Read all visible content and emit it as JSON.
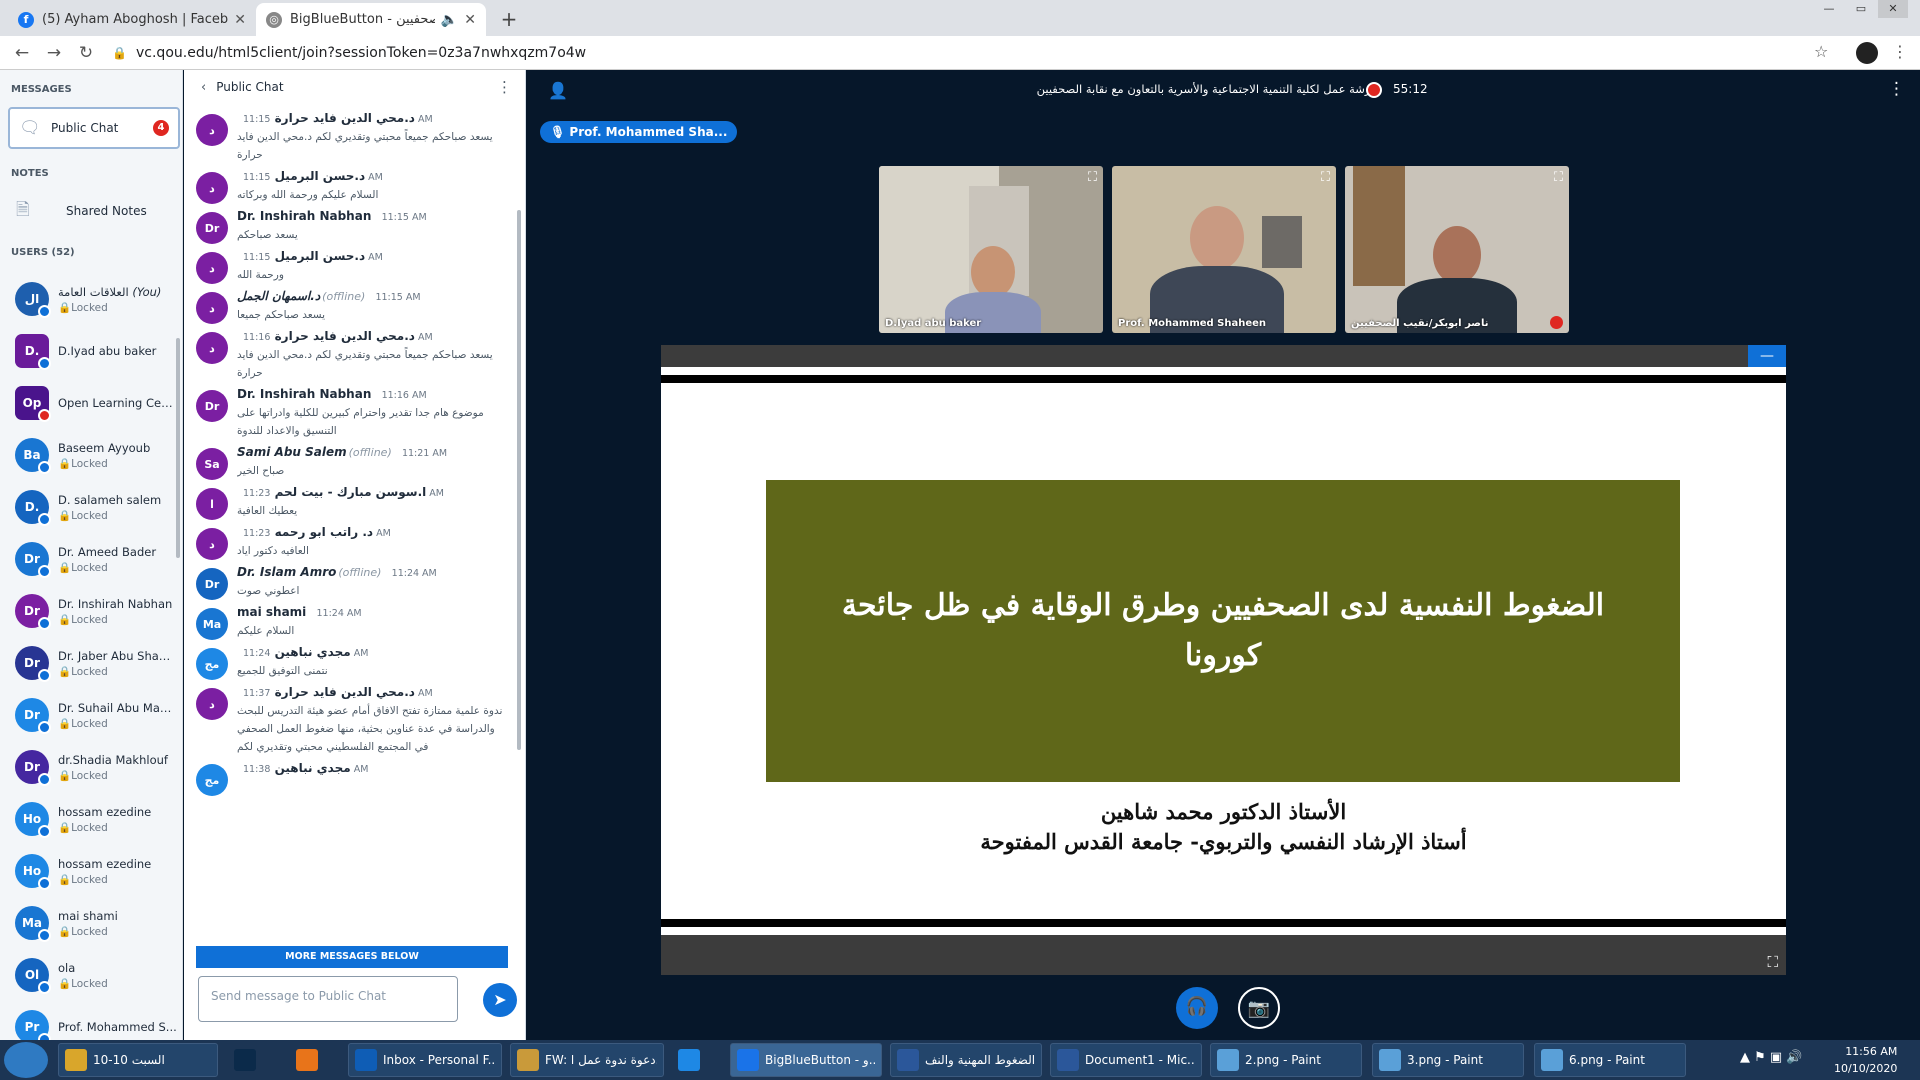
{
  "browser": {
    "tabs": [
      {
        "label": "(5) Ayham Aboghosh | Facebook",
        "icon": "facebook-icon"
      },
      {
        "label": "BigBlueButton - نقابة الصحفيين",
        "icon": "bigbluebutton-icon"
      }
    ],
    "url": "vc.qou.edu/html5client/join?sessionToken=0z3a7nwhxqzm7o4w"
  },
  "left_panel": {
    "messages_title": "MESSAGES",
    "public_chat_label": "Public Chat",
    "public_chat_badge": "4",
    "notes_title": "NOTES",
    "shared_notes_label": "Shared Notes",
    "users_title": "USERS (52)",
    "users": [
      {
        "name": "العلاقات العامة",
        "you": "(You)",
        "status": "Locked",
        "initials": "ال",
        "color": "#1e5fae",
        "dot": "audio",
        "square": false
      },
      {
        "name": "D.Iyad abu baker",
        "status": "",
        "initials": "D.",
        "color": "#6a1b9a",
        "dot": "audio",
        "square": true
      },
      {
        "name": "Open Learning Cent...",
        "status": "",
        "initials": "Op",
        "color": "#4a148c",
        "dot": "mute",
        "square": true
      },
      {
        "name": "Baseem Ayyoub",
        "status": "Locked",
        "initials": "Ba",
        "color": "#1976d2",
        "dot": "audio",
        "square": false
      },
      {
        "name": "D. salameh salem",
        "status": "Locked",
        "initials": "D.",
        "color": "#1565c0",
        "dot": "audio",
        "square": false
      },
      {
        "name": "Dr. Ameed Bader",
        "status": "Locked",
        "initials": "Dr",
        "color": "#1976d2",
        "dot": "audio",
        "square": false
      },
      {
        "name": "Dr. Inshirah Nabhan",
        "status": "Locked",
        "initials": "Dr",
        "color": "#7b1fa2",
        "dot": "audio",
        "square": false
      },
      {
        "name": "Dr. Jaber Abu Shaw...",
        "status": "Locked",
        "initials": "Dr",
        "color": "#283593",
        "dot": "audio",
        "square": false
      },
      {
        "name": "Dr. Suhail Abu Maya...",
        "status": "Locked",
        "initials": "Dr",
        "color": "#1e88e5",
        "dot": "audio",
        "square": false
      },
      {
        "name": "dr.Shadia Makhlouf",
        "status": "Locked",
        "initials": "Dr",
        "color": "#4527a0",
        "dot": "audio",
        "square": false
      },
      {
        "name": "hossam ezedine",
        "status": "Locked",
        "initials": "Ho",
        "color": "#1e88e5",
        "dot": "audio",
        "square": false
      },
      {
        "name": "hossam ezedine",
        "status": "Locked",
        "initials": "Ho",
        "color": "#1e88e5",
        "dot": "audio",
        "square": false
      },
      {
        "name": "mai shami",
        "status": "Locked",
        "initials": "Ma",
        "color": "#1976d2",
        "dot": "audio",
        "square": false
      },
      {
        "name": "ola",
        "status": "Locked",
        "initials": "Ol",
        "color": "#1565c0",
        "dot": "audio",
        "square": false
      },
      {
        "name": "Prof. Mohammed S...",
        "status": "",
        "initials": "Pr",
        "color": "#1e88e5",
        "dot": "audio",
        "square": false
      }
    ]
  },
  "chat": {
    "title": "Public Chat",
    "messages": [
      {
        "name": "د.محي الدين فايد حرارة",
        "offline": "",
        "time": "11:15 AM",
        "text": "يسعد صباحكم جميعاً محبتي وتقديري لكم د.محي الدين فايد حرارة",
        "initials": "د",
        "color": "#7b1fa2",
        "italic": false
      },
      {
        "name": "د.حسن البرميل",
        "offline": "",
        "time": "11:15 AM",
        "text": "السلام عليكم ورحمة الله وبركاته",
        "initials": "د",
        "color": "#7b1fa2",
        "italic": false
      },
      {
        "name": "Dr. Inshirah Nabhan",
        "offline": "",
        "time": "11:15 AM",
        "text": "يسعد صباحكم",
        "initials": "Dr",
        "color": "#7b1fa2",
        "italic": false
      },
      {
        "name": "د.حسن البرميل",
        "offline": "",
        "time": "11:15 AM",
        "text": "ورحمة الله",
        "initials": "د",
        "color": "#7b1fa2",
        "italic": false
      },
      {
        "name": "د.اسمهان الجمل",
        "offline": "(offline)",
        "time": "11:15 AM",
        "text": "يسعد صباحكم جميعا",
        "initials": "د",
        "color": "#7b1fa2",
        "italic": true
      },
      {
        "name": "د.محي الدين فايد حرارة",
        "offline": "",
        "time": "11:16 AM",
        "text": "يسعد صباحكم جميعاً محبتي وتقديري لكم د.محي الدين فايد حرارة",
        "initials": "د",
        "color": "#7b1fa2",
        "italic": false
      },
      {
        "name": "Dr. Inshirah Nabhan",
        "offline": "",
        "time": "11:16 AM",
        "text": "موضوع هام جدا تقدير واحترام كبيرين للكلية وادراتها على التنسيق والاعداد للندوة",
        "initials": "Dr",
        "color": "#7b1fa2",
        "italic": false
      },
      {
        "name": "Sami Abu Salem",
        "offline": "(offline)",
        "time": "11:21 AM",
        "text": "صباح الخير",
        "initials": "Sa",
        "color": "#7b1fa2",
        "italic": true
      },
      {
        "name": "ا.سوسن مبارك - بيت لحم",
        "offline": "",
        "time": "11:23 AM",
        "text": "يعطيك العافية",
        "initials": "ا",
        "color": "#7b1fa2",
        "italic": false
      },
      {
        "name": "د. راتب ابو رحمه",
        "offline": "",
        "time": "11:23 AM",
        "text": "العافيه دكتور اياد",
        "initials": "د",
        "color": "#7b1fa2",
        "italic": false
      },
      {
        "name": "Dr. Islam Amro",
        "offline": "(offline)",
        "time": "11:24 AM",
        "text": "اعطوني صوت",
        "initials": "Dr",
        "color": "#1565c0",
        "italic": true
      },
      {
        "name": "mai shami",
        "offline": "",
        "time": "11:24 AM",
        "text": "السلام عليكم",
        "initials": "Ma",
        "color": "#1976d2",
        "italic": false
      },
      {
        "name": "مجدي نباهين",
        "offline": "",
        "time": "11:24 AM",
        "text": "نتمنى التوفيق للجميع",
        "initials": "مج",
        "color": "#1e88e5",
        "italic": false
      },
      {
        "name": "د.محي الدين فايد حرارة",
        "offline": "",
        "time": "11:37 AM",
        "text": "ندوة علمية ممتازة تفتح الافاق أمام عضو هيئة التدريس للبحث والدراسة في عدة عناوين بحثية، منها ضغوط العمل الصحفي في المجتمع الفلسطيني محبتي وتقديري لكم",
        "initials": "د",
        "color": "#7b1fa2",
        "italic": false
      },
      {
        "name": "مجدي نباهين",
        "offline": "",
        "time": "11:38 AM",
        "text": "",
        "initials": "مج",
        "color": "#1e88e5",
        "italic": false
      }
    ],
    "more_below": "MORE MESSAGES BELOW",
    "input_placeholder": "Send message to Public Chat"
  },
  "main": {
    "meeting_title": "ورشة عمل لكلية التنمية الاجتماعية والأسرية بالتعاون مع نقابة الصحفيين",
    "recording_time": "55:12",
    "talking_indicator": "Prof. Mohammed Sha...",
    "videos": [
      {
        "name": "D.Iyad abu baker"
      },
      {
        "name": "Prof. Mohammed Shaheen"
      },
      {
        "name": "ناصر ابوبكر/نقيب الصحفيين"
      }
    ],
    "slide": {
      "title": "الضغوط النفسية لدى الصحفيين وطرق الوقاية في ظل جائحة كورونا",
      "author_line1": "الأستاذ الدكتور محمد شاهين",
      "author_line2": "أستاذ الإرشاد النفسي والتربوي- جامعة القدس المفتوحة"
    }
  },
  "taskbar": {
    "items": [
      {
        "label": "10-10 السبت",
        "icon": "folder-icon",
        "color": "#d9a62b"
      },
      {
        "label": "",
        "icon": "photoshop-icon",
        "color": "#0b2a4a"
      },
      {
        "label": "",
        "icon": "media-player-icon",
        "color": "#e8741a"
      },
      {
        "label": "Inbox - Personal F...",
        "icon": "outlook-icon",
        "color": "#0f5db5"
      },
      {
        "label": "FW: دعوة ندوة عمل ا...",
        "icon": "mail-icon",
        "color": "#c99a3a"
      },
      {
        "label": "",
        "icon": "ie-icon",
        "color": "#1e88e5"
      },
      {
        "label": "BigBlueButton - و...",
        "icon": "chrome-icon",
        "color": "#1a73e8"
      },
      {
        "label": "الضغوط المهنية والنف...",
        "icon": "word-icon",
        "color": "#2b579a"
      },
      {
        "label": "Document1 - Mic...",
        "icon": "word-icon",
        "color": "#2b579a"
      },
      {
        "label": "2.png - Paint",
        "icon": "paint-icon",
        "color": "#5aa0d8"
      },
      {
        "label": "3.png - Paint",
        "icon": "paint-icon",
        "color": "#5aa0d8"
      },
      {
        "label": "6.png - Paint",
        "icon": "paint-icon",
        "color": "#5aa0d8"
      }
    ],
    "time": "11:56 AM",
    "date": "10/10/2020"
  }
}
